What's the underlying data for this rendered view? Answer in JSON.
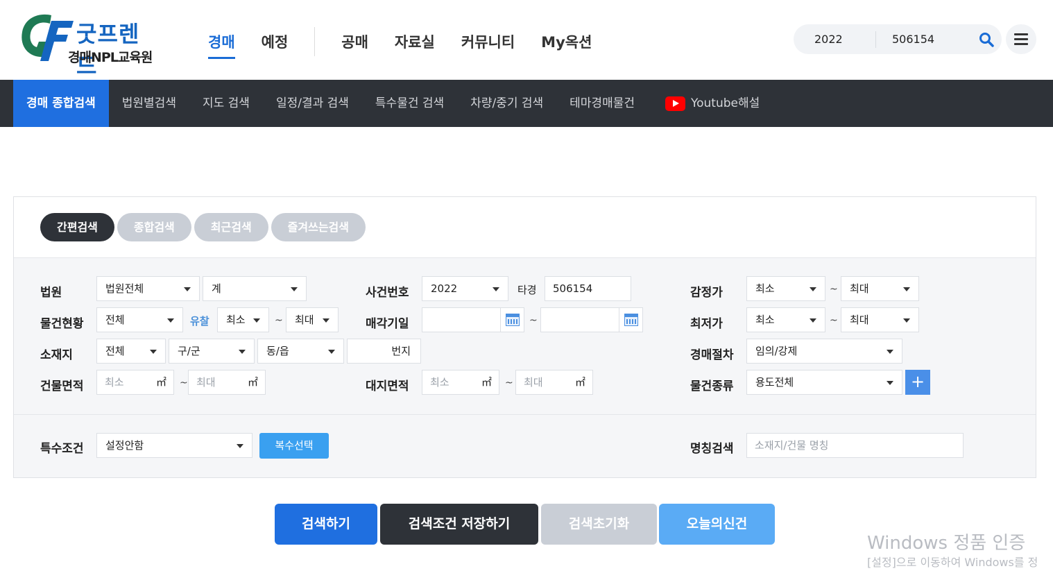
{
  "logo": {
    "top": "굿프렌드",
    "bottom": "경매NPL교육원"
  },
  "gnb": {
    "items": [
      "경매",
      "예정",
      "공매",
      "자료실",
      "커뮤니티",
      "My옥션"
    ]
  },
  "header_search": {
    "year": "2022",
    "number": "506154"
  },
  "subnav": {
    "items": [
      "경매 종합검색",
      "법원별검색",
      "지도 검색",
      "일정/결과 검색",
      "특수물건 검색",
      "차량/중기 검색",
      "테마경매물건"
    ],
    "youtube": "Youtube해설"
  },
  "tabs": [
    "간편검색",
    "종합검색",
    "최근검색",
    "즐겨쓰는검색"
  ],
  "form": {
    "court": {
      "label": "법원",
      "value1": "법원전체",
      "value2": "계"
    },
    "status": {
      "label": "물건현황",
      "value": "전체",
      "fail_label": "유찰",
      "min": "최소",
      "max": "최대"
    },
    "location": {
      "label": "소재지",
      "sido": "전체",
      "gugun": "구/군",
      "dong": "동/읍",
      "bunji": "번지"
    },
    "building_area": {
      "label": "건물면적",
      "min": "최소",
      "max": "최대",
      "unit": "㎡"
    },
    "case_number": {
      "label": "사건번호",
      "year": "2022",
      "type": "타경",
      "number": "506154"
    },
    "sale_date": {
      "label": "매각기일"
    },
    "land_area": {
      "label": "대지면적",
      "min": "최소",
      "max": "최대",
      "unit": "㎡"
    },
    "appraisal": {
      "label": "감정가",
      "min": "최소",
      "max": "최대"
    },
    "min_price": {
      "label": "최저가",
      "min": "최소",
      "max": "최대"
    },
    "procedure": {
      "label": "경매절차",
      "value": "임의/강제"
    },
    "item_type": {
      "label": "물건종류",
      "value": "용도전체",
      "plus": "+"
    },
    "special": {
      "label": "특수조건",
      "value": "설정안함",
      "multi": "복수선택"
    },
    "name_search": {
      "label": "명칭검색",
      "placeholder": "소재지/건물 명칭"
    },
    "tilde": "~"
  },
  "actions": {
    "search": "검색하기",
    "save": "검색조건 저장하기",
    "reset": "검색초기화",
    "today": "오늘의신건"
  },
  "watermark": {
    "line1": "Windows 정품 인증",
    "line2": "[설정]으로 이동하여 Windows를 정"
  },
  "colors": {
    "primary": "#1f6fe0",
    "dark": "#2e3238",
    "disabled": "#c9ced6",
    "light_blue": "#5aabf5"
  }
}
